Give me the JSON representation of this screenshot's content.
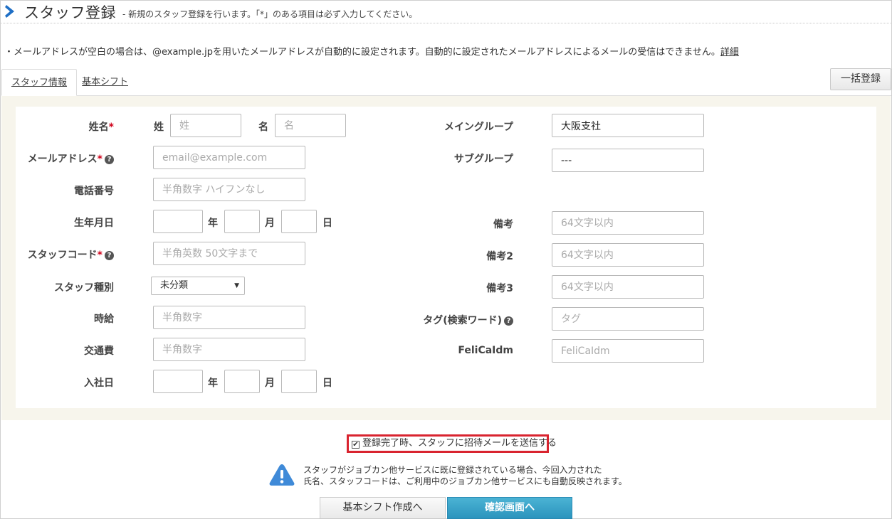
{
  "header": {
    "title": "スタッフ登録",
    "subtitle": "- 新規のスタッフ登録を行います。「*」のある項目は必ず入力してください。"
  },
  "notice": {
    "text": "・メールアドレスが空白の場合は、@example.jpを用いたメールアドレスが自動的に設定されます。自動的に設定されたメールアドレスによるメールの受信はできません。",
    "link": "詳細"
  },
  "tabs": [
    {
      "label": "スタッフ情報",
      "active": true
    },
    {
      "label": "基本シフト",
      "active": false
    }
  ],
  "bulk_button": "一括登録",
  "form": {
    "name": {
      "label": "姓名",
      "required": "*",
      "last_label": "姓",
      "last_placeholder": "姓",
      "first_label": "名",
      "first_placeholder": "名"
    },
    "email": {
      "label": "メールアドレス",
      "required": "*",
      "placeholder": "email@example.com"
    },
    "phone": {
      "label": "電話番号",
      "placeholder": "半角数字 ハイフンなし"
    },
    "birthday": {
      "label": "生年月日",
      "year": "年",
      "month": "月",
      "day": "日"
    },
    "staff_code": {
      "label": "スタッフコード",
      "required": "*",
      "placeholder": "半角英数 50文字まで"
    },
    "staff_type": {
      "label": "スタッフ種別",
      "value": "未分類"
    },
    "hourly": {
      "label": "時給",
      "placeholder": "半角数字"
    },
    "transport": {
      "label": "交通費",
      "placeholder": "半角数字"
    },
    "join_date": {
      "label": "入社日",
      "year": "年",
      "month": "月",
      "day": "日"
    },
    "main_group": {
      "label": "メイングループ",
      "value": "大阪支社"
    },
    "sub_group": {
      "label": "サブグループ",
      "value": "---"
    },
    "note1": {
      "label": "備考",
      "placeholder": "64文字以内"
    },
    "note2": {
      "label": "備考2",
      "placeholder": "64文字以内"
    },
    "note3": {
      "label": "備考3",
      "placeholder": "64文字以内"
    },
    "tag": {
      "label": "タグ(検索ワード)",
      "placeholder": "タグ"
    },
    "felica": {
      "label": "FeliCaIdm",
      "placeholder": "FeliCaIdm"
    }
  },
  "invite": {
    "label": "登録完了時、スタッフに招待メールを送信する",
    "checked": true
  },
  "warning": {
    "line1": "スタッフがジョブカン他サービスに既に登録されている場合、今回入力された",
    "line2": "氏名、スタッフコードは、ご利用中のジョブカン他サービスにも自動反映されます。"
  },
  "buttons": {
    "shift": "基本シフト作成へ",
    "confirm": "確認画面へ"
  },
  "colors": {
    "accent": "#2b94bd",
    "required": "#d0021b",
    "highlight_border": "#d9242f",
    "panel_bg": "#f7f5ec"
  }
}
